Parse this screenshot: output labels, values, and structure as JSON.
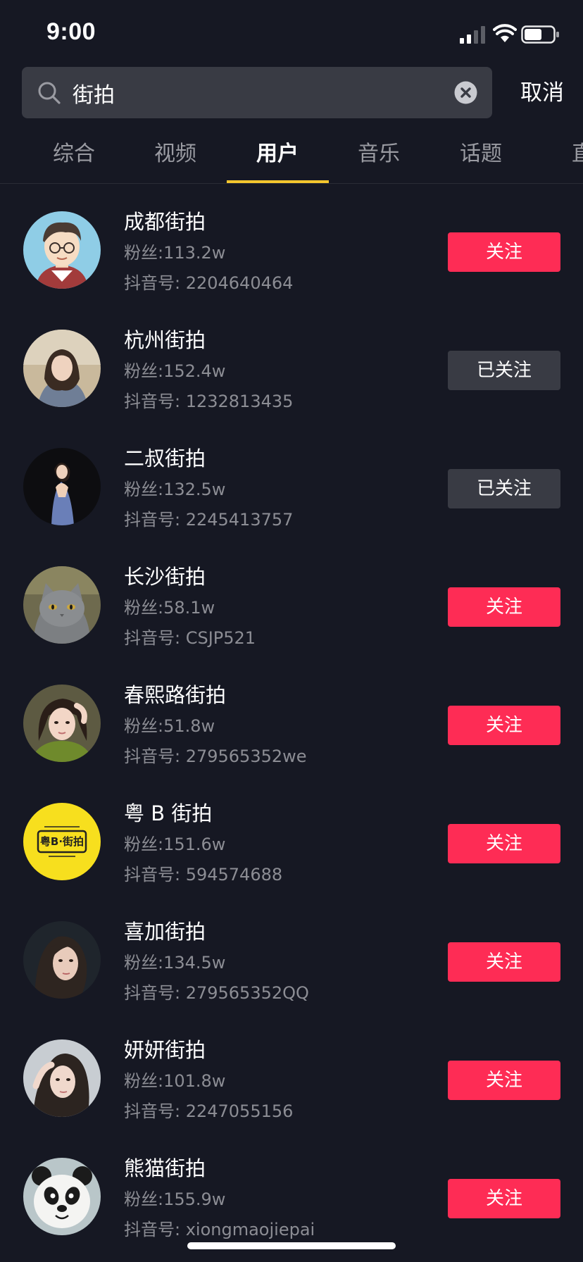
{
  "status_bar": {
    "time": "9:00"
  },
  "search": {
    "query": "街拍",
    "cancel_label": "取消"
  },
  "tabs": [
    {
      "label": "综合"
    },
    {
      "label": "视频"
    },
    {
      "label": "用户"
    },
    {
      "label": "音乐"
    },
    {
      "label": "话题"
    },
    {
      "label": "直"
    }
  ],
  "active_tab": "用户",
  "colors": {
    "background": "#161823",
    "follow_red": "#fe2c55",
    "followed_gray": "#393b44",
    "tab_underline": "#f4c62e"
  },
  "users": [
    {
      "name": "成都街拍",
      "fans": "粉丝:113.2w",
      "id": "抖音号: 2204640464",
      "button": "关注",
      "followed": false,
      "avatar": "cartoon-man-avatar"
    },
    {
      "name": "杭州街拍",
      "fans": "粉丝:152.4w",
      "id": "抖音号: 1232813435",
      "button": "已关注",
      "followed": true,
      "avatar": "woman-portrait-avatar"
    },
    {
      "name": "二叔街拍",
      "fans": "粉丝:132.5w",
      "id": "抖音号: 2245413757",
      "button": "已关注",
      "followed": true,
      "avatar": "woman-in-dress-avatar"
    },
    {
      "name": "长沙街拍",
      "fans": "粉丝:58.1w",
      "id": "抖音号: CSJP521",
      "button": "关注",
      "followed": false,
      "avatar": "gray-cat-avatar"
    },
    {
      "name": "春熙路街拍",
      "fans": "粉丝:51.8w",
      "id": "抖音号: 279565352we",
      "button": "关注",
      "followed": false,
      "avatar": "girl-green-sweater-avatar"
    },
    {
      "name": "粤 B 街拍",
      "fans": "粉丝:151.6w",
      "id": "抖音号: 594574688",
      "button": "关注",
      "followed": false,
      "avatar": "yellow-logo-avatar",
      "logo_text": "粤B·街拍"
    },
    {
      "name": "喜加街拍",
      "fans": "粉丝:134.5w",
      "id": "抖音号: 279565352QQ",
      "button": "关注",
      "followed": false,
      "avatar": "girl-dark-background-avatar"
    },
    {
      "name": "妍妍街拍",
      "fans": "粉丝:101.8w",
      "id": "抖音号: 2247055156",
      "button": "关注",
      "followed": false,
      "avatar": "girl-hand-on-head-avatar"
    },
    {
      "name": "熊猫街拍",
      "fans": "粉丝:155.9w",
      "id": "抖音号: xiongmaojiepai",
      "button": "关注",
      "followed": false,
      "avatar": "panda-avatar"
    }
  ]
}
